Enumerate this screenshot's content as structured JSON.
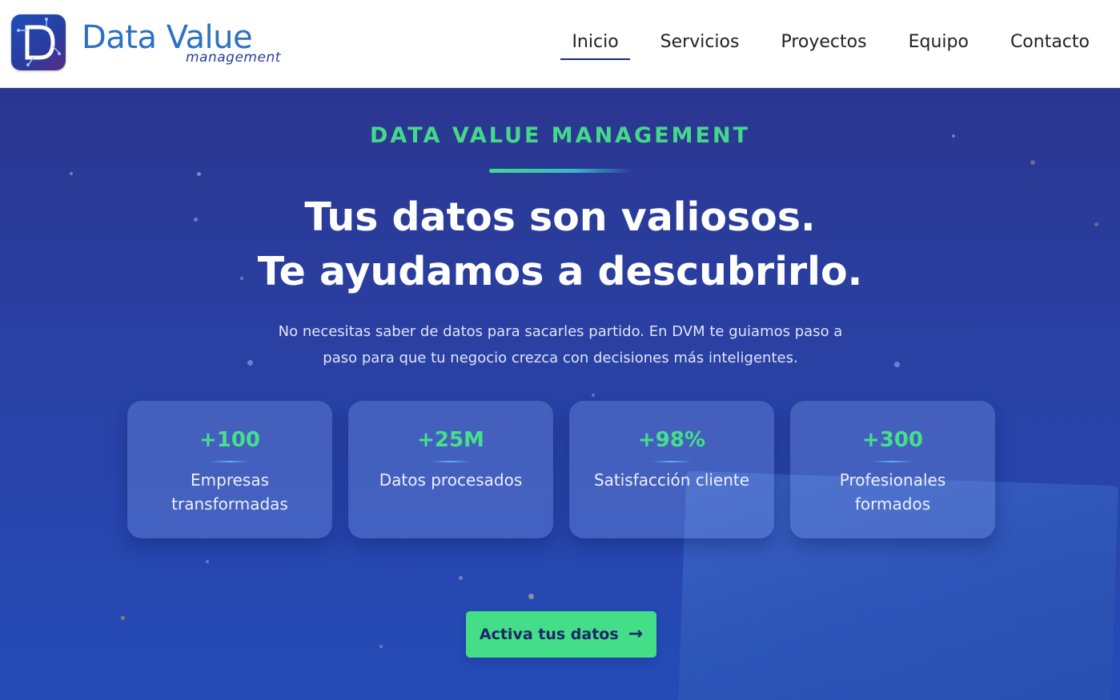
{
  "brand": {
    "title": "Data Value",
    "subtitle": "management",
    "colors": {
      "primary": "#2b72c2",
      "accent": "#44d98a",
      "navy": "#2c3d9d"
    }
  },
  "nav": {
    "items": [
      {
        "label": "Inicio",
        "active": true
      },
      {
        "label": "Servicios"
      },
      {
        "label": "Proyectos"
      },
      {
        "label": "Equipo"
      },
      {
        "label": "Contacto"
      }
    ]
  },
  "hero": {
    "eyebrow": "DATA VALUE MANAGEMENT",
    "headline_line1": "Tus datos son valiosos.",
    "headline_line2": "Te ayudamos a descubrirlo.",
    "subtitle": "No necesitas saber de datos para sacarles partido. En DVM te guiamos paso a paso para que tu negocio crezca con decisiones más inteligentes.",
    "cta_label": "Activa tus datos",
    "cta_icon": "arrow-right-icon"
  },
  "stats": [
    {
      "value": "+100",
      "label": "Empresas transformadas"
    },
    {
      "value": "+25M",
      "label": "Datos procesados"
    },
    {
      "value": "+98%",
      "label": "Satisfacción cliente"
    },
    {
      "value": "+300",
      "label": "Profesionales formados"
    }
  ]
}
